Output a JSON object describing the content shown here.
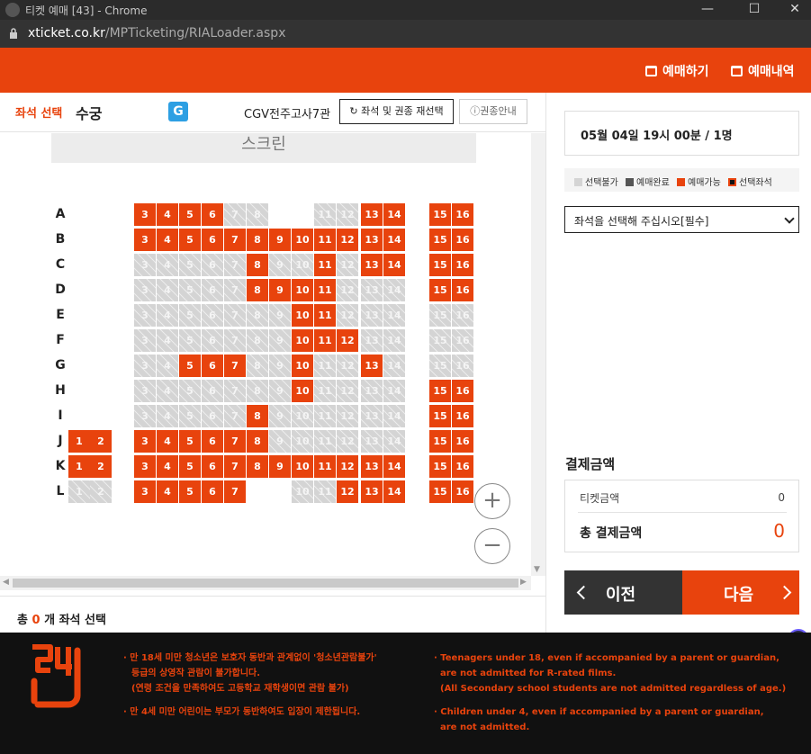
{
  "window": {
    "title": "티켓 예매 [43] - Chrome"
  },
  "addressbar": {
    "domain": "xticket.co.kr",
    "path": "/MPTicketing/RIALoader.aspx"
  },
  "nav": {
    "reserve": "예매하기",
    "history": "예매내역"
  },
  "header": {
    "seat_select": "좌석 선택",
    "movie": "수궁",
    "rating": "G",
    "theater": "CGV전주고사7관",
    "reselect_button": "좌석 및 권종 재선택",
    "guide_button": "권종안내"
  },
  "screen_label": "스크린",
  "seat_rows": [
    {
      "row": "A",
      "seats": [
        {
          "n": "3",
          "avail": true
        },
        {
          "n": "4",
          "avail": true
        },
        {
          "n": "5",
          "avail": true
        },
        {
          "n": "6",
          "avail": true
        },
        {
          "n": "7",
          "avail": false
        },
        {
          "n": "8",
          "avail": false
        },
        {
          "n": "11",
          "avail": false
        },
        {
          "n": "12",
          "avail": false
        },
        {
          "n": "13",
          "avail": true
        },
        {
          "n": "14",
          "avail": true
        },
        {
          "n": "15",
          "avail": true
        },
        {
          "n": "16",
          "avail": true
        }
      ]
    },
    {
      "row": "B",
      "seats": [
        {
          "n": "3",
          "avail": true
        },
        {
          "n": "4",
          "avail": true
        },
        {
          "n": "5",
          "avail": true
        },
        {
          "n": "6",
          "avail": true
        },
        {
          "n": "7",
          "avail": true
        },
        {
          "n": "8",
          "avail": true
        },
        {
          "n": "9",
          "avail": true
        },
        {
          "n": "10",
          "avail": true
        },
        {
          "n": "11",
          "avail": true
        },
        {
          "n": "12",
          "avail": true
        },
        {
          "n": "13",
          "avail": true
        },
        {
          "n": "14",
          "avail": true
        },
        {
          "n": "15",
          "avail": true
        },
        {
          "n": "16",
          "avail": true
        }
      ]
    },
    {
      "row": "C",
      "seats": [
        {
          "n": "3",
          "avail": false
        },
        {
          "n": "4",
          "avail": false
        },
        {
          "n": "5",
          "avail": false
        },
        {
          "n": "6",
          "avail": false
        },
        {
          "n": "7",
          "avail": false
        },
        {
          "n": "8",
          "avail": true
        },
        {
          "n": "9",
          "avail": false
        },
        {
          "n": "10",
          "avail": false
        },
        {
          "n": "11",
          "avail": true
        },
        {
          "n": "12",
          "avail": false
        },
        {
          "n": "13",
          "avail": true
        },
        {
          "n": "14",
          "avail": true
        },
        {
          "n": "15",
          "avail": true
        },
        {
          "n": "16",
          "avail": true
        }
      ]
    },
    {
      "row": "D",
      "seats": [
        {
          "n": "3",
          "avail": false
        },
        {
          "n": "4",
          "avail": false
        },
        {
          "n": "5",
          "avail": false
        },
        {
          "n": "6",
          "avail": false
        },
        {
          "n": "7",
          "avail": false
        },
        {
          "n": "8",
          "avail": true
        },
        {
          "n": "9",
          "avail": true
        },
        {
          "n": "10",
          "avail": true
        },
        {
          "n": "11",
          "avail": true
        },
        {
          "n": "12",
          "avail": false
        },
        {
          "n": "13",
          "avail": false
        },
        {
          "n": "14",
          "avail": false
        },
        {
          "n": "15",
          "avail": true
        },
        {
          "n": "16",
          "avail": true
        }
      ]
    },
    {
      "row": "E",
      "seats": [
        {
          "n": "3",
          "avail": false
        },
        {
          "n": "4",
          "avail": false
        },
        {
          "n": "5",
          "avail": false
        },
        {
          "n": "6",
          "avail": false
        },
        {
          "n": "7",
          "avail": false
        },
        {
          "n": "8",
          "avail": false
        },
        {
          "n": "9",
          "avail": false
        },
        {
          "n": "10",
          "avail": true
        },
        {
          "n": "11",
          "avail": true
        },
        {
          "n": "12",
          "avail": false
        },
        {
          "n": "13",
          "avail": false
        },
        {
          "n": "14",
          "avail": false
        },
        {
          "n": "15",
          "avail": false
        },
        {
          "n": "16",
          "avail": false
        }
      ]
    },
    {
      "row": "F",
      "seats": [
        {
          "n": "3",
          "avail": false
        },
        {
          "n": "4",
          "avail": false
        },
        {
          "n": "5",
          "avail": false
        },
        {
          "n": "6",
          "avail": false
        },
        {
          "n": "7",
          "avail": false
        },
        {
          "n": "8",
          "avail": false
        },
        {
          "n": "9",
          "avail": false
        },
        {
          "n": "10",
          "avail": true
        },
        {
          "n": "11",
          "avail": true
        },
        {
          "n": "12",
          "avail": true
        },
        {
          "n": "13",
          "avail": false
        },
        {
          "n": "14",
          "avail": false
        },
        {
          "n": "15",
          "avail": false
        },
        {
          "n": "16",
          "avail": false
        }
      ]
    },
    {
      "row": "G",
      "seats": [
        {
          "n": "3",
          "avail": false
        },
        {
          "n": "4",
          "avail": false
        },
        {
          "n": "5",
          "avail": true
        },
        {
          "n": "6",
          "avail": true
        },
        {
          "n": "7",
          "avail": true
        },
        {
          "n": "8",
          "avail": false
        },
        {
          "n": "9",
          "avail": false
        },
        {
          "n": "10",
          "avail": true
        },
        {
          "n": "11",
          "avail": false
        },
        {
          "n": "12",
          "avail": false
        },
        {
          "n": "13",
          "avail": true
        },
        {
          "n": "14",
          "avail": false
        },
        {
          "n": "15",
          "avail": false
        },
        {
          "n": "16",
          "avail": false
        }
      ]
    },
    {
      "row": "H",
      "seats": [
        {
          "n": "3",
          "avail": false
        },
        {
          "n": "4",
          "avail": false
        },
        {
          "n": "5",
          "avail": false
        },
        {
          "n": "6",
          "avail": false
        },
        {
          "n": "7",
          "avail": false
        },
        {
          "n": "8",
          "avail": false
        },
        {
          "n": "9",
          "avail": false
        },
        {
          "n": "10",
          "avail": true
        },
        {
          "n": "11",
          "avail": false
        },
        {
          "n": "12",
          "avail": false
        },
        {
          "n": "13",
          "avail": false
        },
        {
          "n": "14",
          "avail": false
        },
        {
          "n": "15",
          "avail": true
        },
        {
          "n": "16",
          "avail": true
        }
      ]
    },
    {
      "row": "I",
      "seats": [
        {
          "n": "3",
          "avail": false
        },
        {
          "n": "4",
          "avail": false
        },
        {
          "n": "5",
          "avail": false
        },
        {
          "n": "6",
          "avail": false
        },
        {
          "n": "7",
          "avail": false
        },
        {
          "n": "8",
          "avail": true
        },
        {
          "n": "9",
          "avail": false
        },
        {
          "n": "10",
          "avail": false
        },
        {
          "n": "11",
          "avail": false
        },
        {
          "n": "12",
          "avail": false
        },
        {
          "n": "13",
          "avail": false
        },
        {
          "n": "14",
          "avail": false
        },
        {
          "n": "15",
          "avail": true
        },
        {
          "n": "16",
          "avail": true
        }
      ]
    },
    {
      "row": "J",
      "seats": [
        {
          "n": "1",
          "avail": true
        },
        {
          "n": "2",
          "avail": true
        },
        {
          "n": "3",
          "avail": true
        },
        {
          "n": "4",
          "avail": true
        },
        {
          "n": "5",
          "avail": true
        },
        {
          "n": "6",
          "avail": true
        },
        {
          "n": "7",
          "avail": true
        },
        {
          "n": "8",
          "avail": true
        },
        {
          "n": "9",
          "avail": false
        },
        {
          "n": "10",
          "avail": false
        },
        {
          "n": "11",
          "avail": false
        },
        {
          "n": "12",
          "avail": false
        },
        {
          "n": "13",
          "avail": false
        },
        {
          "n": "14",
          "avail": false
        },
        {
          "n": "15",
          "avail": true
        },
        {
          "n": "16",
          "avail": true
        }
      ]
    },
    {
      "row": "K",
      "seats": [
        {
          "n": "1",
          "avail": true
        },
        {
          "n": "2",
          "avail": true
        },
        {
          "n": "3",
          "avail": true
        },
        {
          "n": "4",
          "avail": true
        },
        {
          "n": "5",
          "avail": true
        },
        {
          "n": "6",
          "avail": true
        },
        {
          "n": "7",
          "avail": true
        },
        {
          "n": "8",
          "avail": true
        },
        {
          "n": "9",
          "avail": true
        },
        {
          "n": "10",
          "avail": true
        },
        {
          "n": "11",
          "avail": true
        },
        {
          "n": "12",
          "avail": true
        },
        {
          "n": "13",
          "avail": true
        },
        {
          "n": "14",
          "avail": true
        },
        {
          "n": "15",
          "avail": true
        },
        {
          "n": "16",
          "avail": true
        }
      ]
    },
    {
      "row": "L",
      "seats": [
        {
          "n": "1",
          "avail": false
        },
        {
          "n": "2",
          "avail": false
        },
        {
          "n": "3",
          "avail": true
        },
        {
          "n": "4",
          "avail": true
        },
        {
          "n": "5",
          "avail": true
        },
        {
          "n": "6",
          "avail": true
        },
        {
          "n": "7",
          "avail": true
        },
        {
          "n": "10",
          "avail": false
        },
        {
          "n": "11",
          "avail": false
        },
        {
          "n": "12",
          "avail": true
        },
        {
          "n": "13",
          "avail": true
        },
        {
          "n": "14",
          "avail": true
        },
        {
          "n": "15",
          "avail": true
        },
        {
          "n": "16",
          "avail": true
        }
      ]
    }
  ],
  "zoom": {
    "in": "+",
    "out": "−"
  },
  "selection": {
    "prefix": "총",
    "count": "0",
    "suffix": "개 좌석 선택"
  },
  "schedule": "05월 04일 19시 00분 / 1명",
  "legend": {
    "unavailable": "선택불가",
    "sold": "예매완료",
    "available": "예매가능",
    "selected": "선택좌석"
  },
  "ticket_select": {
    "value": "좌석을 선택해 주십시오[필수]"
  },
  "payment": {
    "title": "결제금액",
    "ticket_label": "티켓금액",
    "ticket_value": "0",
    "total_label": "총 결제금액",
    "total_value": "0"
  },
  "buttons": {
    "prev": "이전",
    "next": "다음"
  },
  "footer": {
    "kr_notices": [
      "· 만 18세 미만 청소년은 보호자 동반과 관계없이 '청소년관람불가'",
      "등급의 상영작 관람이 불가합니다.",
      "(연령 조건을 만족하여도 고등학교 재학생이면 관람 불가)",
      "· 만 4세 미만 어린이는 부모가 동반하여도 입장이 제한됩니다."
    ],
    "en_notices": [
      "· Teenagers under 18, even if accompanied by a parent or guardian,",
      "are not admitted for R-rated films.",
      "(All Secondary school students are not admitted regardless of age.)",
      "· Children under 4, even if accompanied by a parent or guardian,",
      "are not admitted."
    ]
  },
  "colors": {
    "brand": "#e8430d",
    "dark": "#333333",
    "seat_off": "#d4d4d4"
  }
}
